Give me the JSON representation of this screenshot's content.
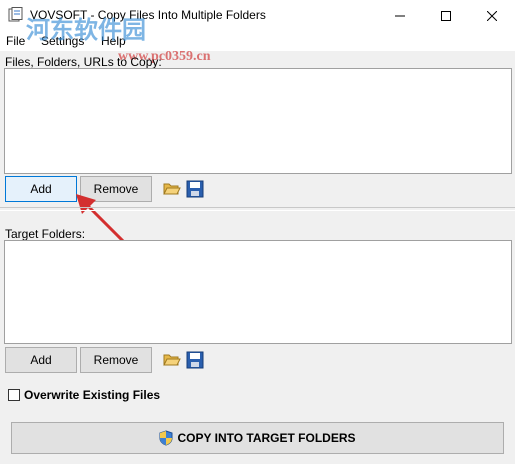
{
  "window": {
    "title": "VOVSOFT - Copy Files Into Multiple Folders",
    "controls": [
      "minimize",
      "maximize",
      "close"
    ]
  },
  "menu": {
    "items": [
      "File",
      "Settings",
      "Help"
    ]
  },
  "sources": {
    "label": "Files, Folders, URLs to Copy:",
    "items": [],
    "add_label": "Add",
    "remove_label": "Remove",
    "open_icon": "folder-open-icon",
    "save_icon": "save-disk-icon"
  },
  "targets": {
    "label": "Target Folders:",
    "items": [],
    "add_label": "Add",
    "remove_label": "Remove",
    "open_icon": "folder-open-icon",
    "save_icon": "save-disk-icon"
  },
  "options": {
    "overwrite_label": "Overwrite Existing Files",
    "overwrite_checked": false
  },
  "action": {
    "copy_label": "COPY INTO TARGET FOLDERS",
    "icon": "uac-shield-icon"
  },
  "watermark": {
    "text": "河东软件园",
    "url": "www.pc0359.cn"
  },
  "colors": {
    "annotation_arrow": "#d32f2f",
    "watermark_blue": "#3a8fd6"
  }
}
